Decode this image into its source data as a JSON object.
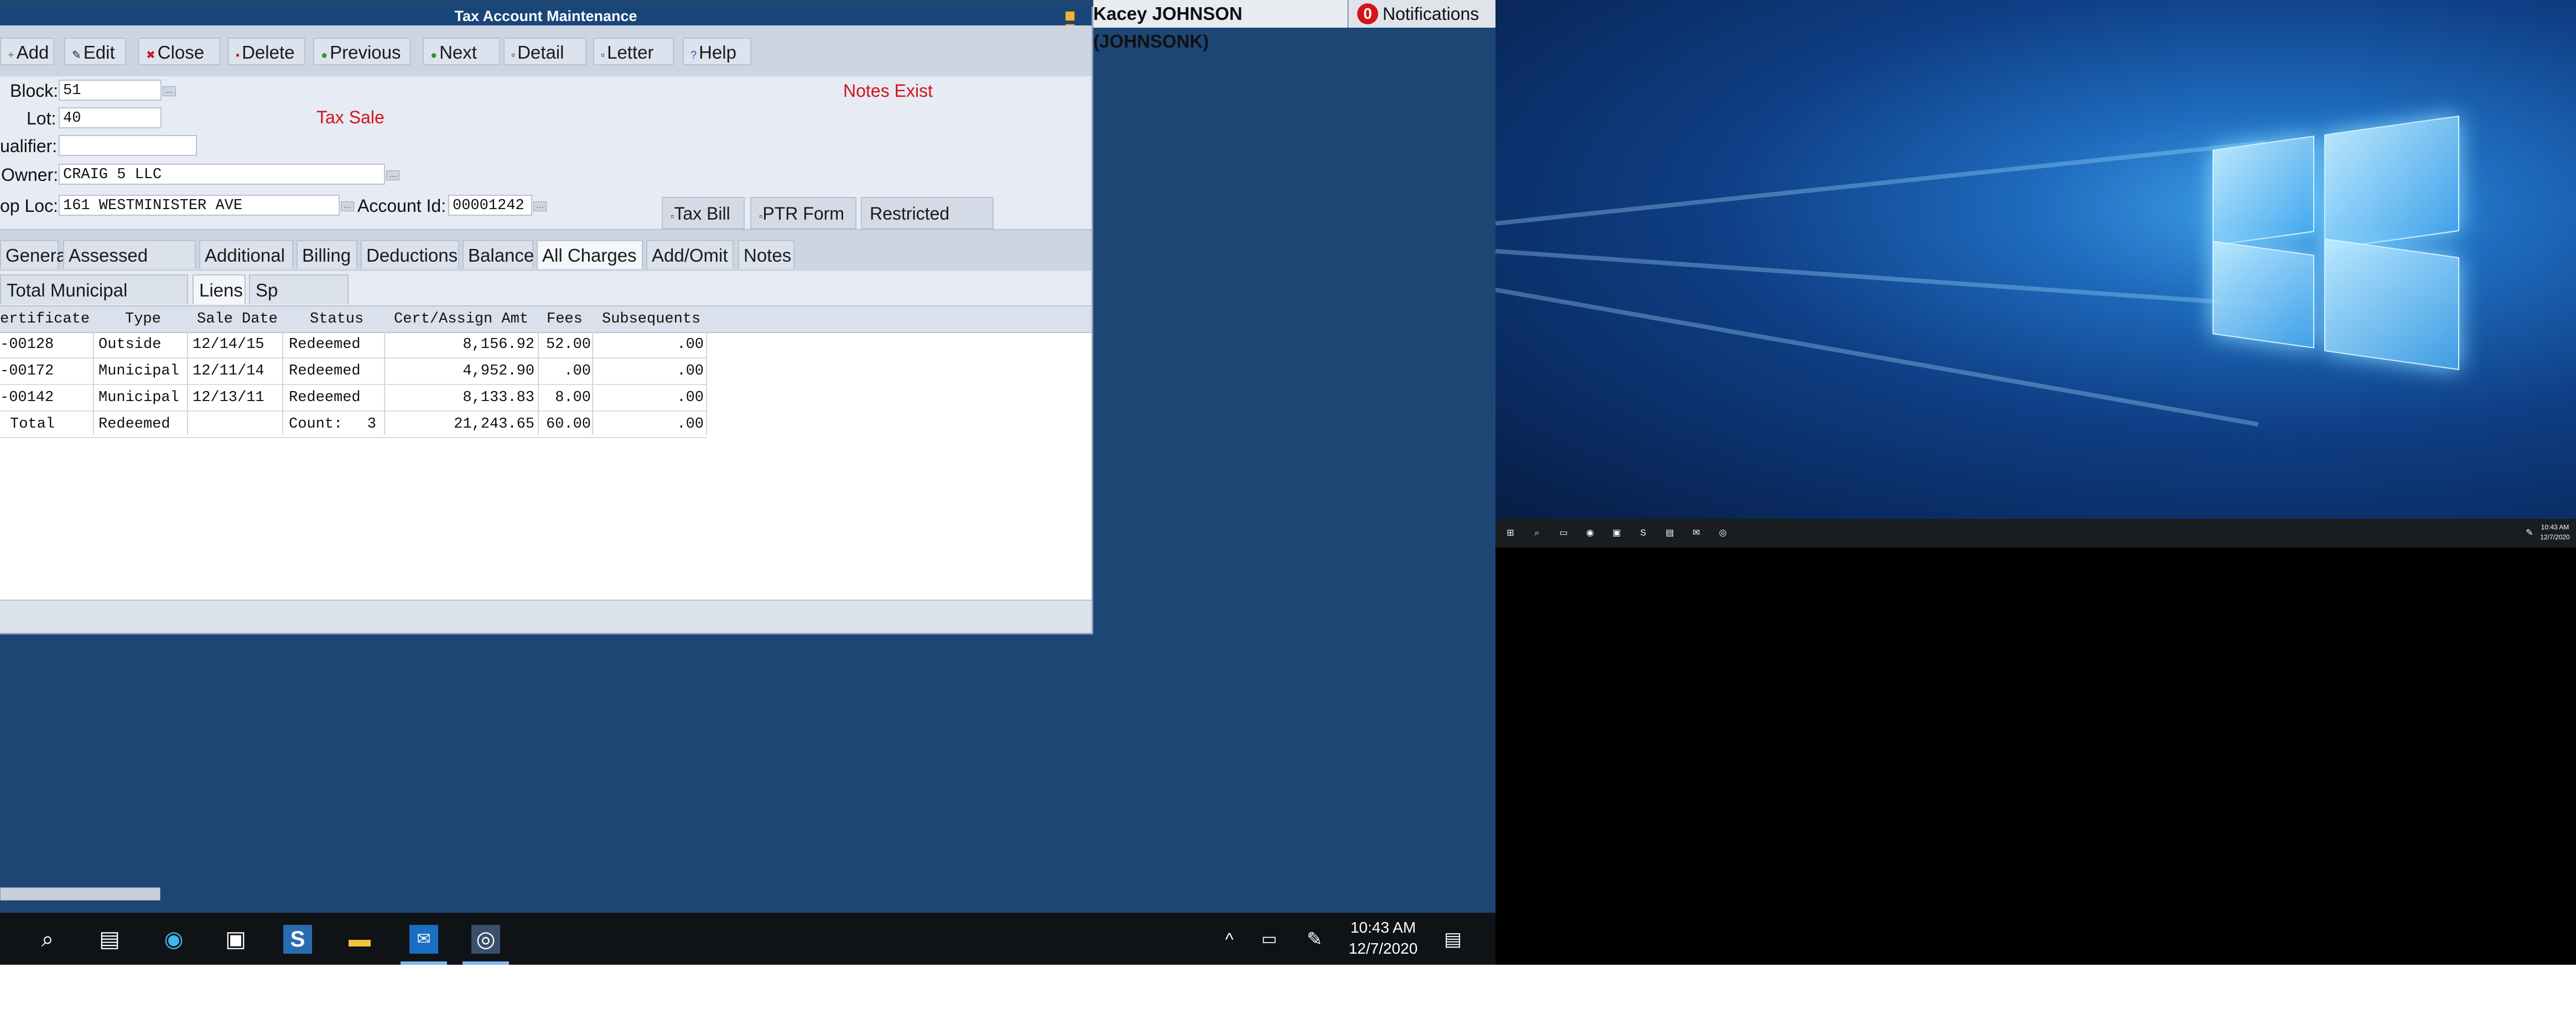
{
  "window": {
    "title": "Tax Account Maintenance"
  },
  "toolbar": {
    "add": "Add",
    "edit": "Edit",
    "close": "Close",
    "delete": "Delete",
    "previous": "Previous",
    "next": "Next",
    "detail": "Detail",
    "letter": "Letter",
    "help": "Help"
  },
  "form": {
    "block_label": "Block:",
    "block_value": "51",
    "lot_label": "Lot:",
    "lot_value": "40",
    "qualifier_label": "ualifier:",
    "qualifier_value": "",
    "owner_label": "Owner:",
    "owner_value": "CRAIG 5 LLC",
    "proploc_label": "op Loc:",
    "proploc_value": "161 WESTMINISTER AVE",
    "account_id_label": "Account Id:",
    "account_id_value": "00001242",
    "tax_sale": "Tax Sale",
    "notes_exist": "Notes Exist"
  },
  "actions": {
    "tax_bill": "Tax Bill",
    "ptr_form": "PTR Form",
    "restricted_edit": "Restricted Edit"
  },
  "tabs": [
    {
      "label": "General",
      "active": false,
      "red": false
    },
    {
      "label": "Assessed Value",
      "active": false,
      "red": false
    },
    {
      "label": "Additional",
      "active": false,
      "red": false
    },
    {
      "label": "Billing",
      "active": false,
      "red": false
    },
    {
      "label": "Deductions",
      "active": false,
      "red": false
    },
    {
      "label": "Balance",
      "active": false,
      "red": false
    },
    {
      "label": "All Charges",
      "active": true,
      "red": false
    },
    {
      "label": "Add/Omit",
      "active": false,
      "red": false
    },
    {
      "label": "Notes",
      "active": false,
      "red": true
    }
  ],
  "subtabs": [
    {
      "label": "Total Municipal Charges",
      "active": false
    },
    {
      "label": "Liens",
      "active": true
    },
    {
      "label": "Sp Charges",
      "active": false
    }
  ],
  "grid": {
    "columns": [
      "ertificate",
      "Type",
      "Sale Date",
      "Status",
      "Cert/Assign Amt",
      "Fees",
      "Subsequents"
    ],
    "rows": [
      {
        "certificate": "-00128",
        "type": "Outside",
        "sale_date": "12/14/15",
        "status": "Redeemed",
        "amount": "8,156.92",
        "fees": "52.00",
        "subsequents": ".00"
      },
      {
        "certificate": "-00172",
        "type": "Municipal",
        "sale_date": "12/11/14",
        "status": "Redeemed",
        "amount": "4,952.90",
        "fees": ".00",
        "subsequents": ".00"
      },
      {
        "certificate": "-00142",
        "type": "Municipal",
        "sale_date": "12/13/11",
        "status": "Redeemed",
        "amount": "8,133.83",
        "fees": "8.00",
        "subsequents": ".00"
      }
    ],
    "total": {
      "label": "Total",
      "type": "Redeemed",
      "count_label": "Count:",
      "count": "3",
      "amount": "21,243.65",
      "fees": "60.00",
      "subsequents": ".00"
    }
  },
  "header": {
    "user": "Kacey JOHNSON (JOHNSONK)",
    "notif_count": "0",
    "notif_label": "Notifications"
  },
  "taskbar": {
    "time": "10:43 AM",
    "date": "12/7/2020",
    "icons": [
      "search-icon",
      "task-view-icon",
      "edge-icon",
      "store-icon",
      "s-app-icon",
      "file-explorer-icon",
      "outlook-icon",
      "chrome-app-icon"
    ]
  },
  "taskbar2": {
    "time": "10:43 AM",
    "date": "12/7/2020"
  }
}
